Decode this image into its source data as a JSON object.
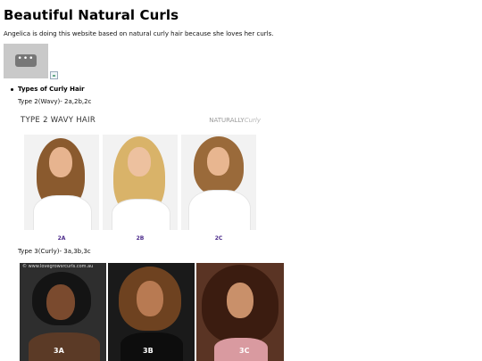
{
  "page": {
    "title": "Beautiful Natural Curls",
    "intro": "Angelica is doing this website based on natural curly hair because she loves her curls."
  },
  "embed": {
    "button_label": "•••",
    "icon": "more-horizontal-icon"
  },
  "broken_image": {
    "icon": "broken-image-icon"
  },
  "section": {
    "heading": "Types of Curly Hair",
    "type2_text": "Type 2(Wavy)- 2a,2b,2c",
    "type3_text": "Type 3(Curly)- 3a,3b,3c"
  },
  "wavy_image": {
    "header": "TYPE 2 WAVY HAIR",
    "brand": "NATURALLY",
    "brand_script": "Curly",
    "labels": [
      "2A",
      "2B",
      "2C"
    ]
  },
  "curly_image": {
    "watermark": "© www.lovegrowsrcurls.com.au",
    "labels": [
      "3A",
      "3B",
      "3C"
    ]
  },
  "colors": {
    "wavy_label": "#4b2a8a",
    "embed_bg": "#c9c9c9"
  }
}
